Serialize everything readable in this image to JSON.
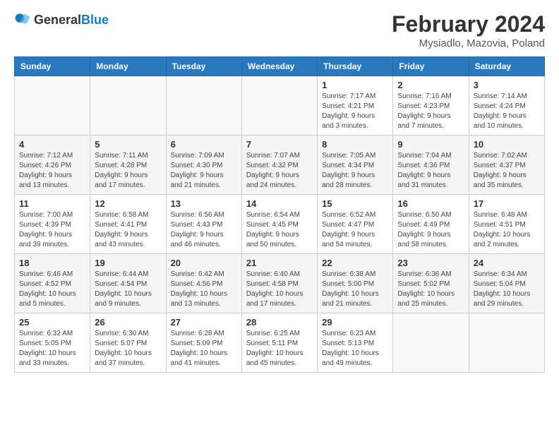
{
  "logo": {
    "general": "General",
    "blue": "Blue"
  },
  "header": {
    "title": "February 2024",
    "subtitle": "Mysiadlo, Mazovia, Poland"
  },
  "weekdays": [
    "Sunday",
    "Monday",
    "Tuesday",
    "Wednesday",
    "Thursday",
    "Friday",
    "Saturday"
  ],
  "weeks": [
    [
      {
        "day": "",
        "detail": ""
      },
      {
        "day": "",
        "detail": ""
      },
      {
        "day": "",
        "detail": ""
      },
      {
        "day": "",
        "detail": ""
      },
      {
        "day": "1",
        "detail": "Sunrise: 7:17 AM\nSunset: 4:21 PM\nDaylight: 9 hours\nand 3 minutes."
      },
      {
        "day": "2",
        "detail": "Sunrise: 7:16 AM\nSunset: 4:23 PM\nDaylight: 9 hours\nand 7 minutes."
      },
      {
        "day": "3",
        "detail": "Sunrise: 7:14 AM\nSunset: 4:24 PM\nDaylight: 9 hours\nand 10 minutes."
      }
    ],
    [
      {
        "day": "4",
        "detail": "Sunrise: 7:12 AM\nSunset: 4:26 PM\nDaylight: 9 hours\nand 13 minutes."
      },
      {
        "day": "5",
        "detail": "Sunrise: 7:11 AM\nSunset: 4:28 PM\nDaylight: 9 hours\nand 17 minutes."
      },
      {
        "day": "6",
        "detail": "Sunrise: 7:09 AM\nSunset: 4:30 PM\nDaylight: 9 hours\nand 21 minutes."
      },
      {
        "day": "7",
        "detail": "Sunrise: 7:07 AM\nSunset: 4:32 PM\nDaylight: 9 hours\nand 24 minutes."
      },
      {
        "day": "8",
        "detail": "Sunrise: 7:05 AM\nSunset: 4:34 PM\nDaylight: 9 hours\nand 28 minutes."
      },
      {
        "day": "9",
        "detail": "Sunrise: 7:04 AM\nSunset: 4:36 PM\nDaylight: 9 hours\nand 31 minutes."
      },
      {
        "day": "10",
        "detail": "Sunrise: 7:02 AM\nSunset: 4:37 PM\nDaylight: 9 hours\nand 35 minutes."
      }
    ],
    [
      {
        "day": "11",
        "detail": "Sunrise: 7:00 AM\nSunset: 4:39 PM\nDaylight: 9 hours\nand 39 minutes."
      },
      {
        "day": "12",
        "detail": "Sunrise: 6:58 AM\nSunset: 4:41 PM\nDaylight: 9 hours\nand 43 minutes."
      },
      {
        "day": "13",
        "detail": "Sunrise: 6:56 AM\nSunset: 4:43 PM\nDaylight: 9 hours\nand 46 minutes."
      },
      {
        "day": "14",
        "detail": "Sunrise: 6:54 AM\nSunset: 4:45 PM\nDaylight: 9 hours\nand 50 minutes."
      },
      {
        "day": "15",
        "detail": "Sunrise: 6:52 AM\nSunset: 4:47 PM\nDaylight: 9 hours\nand 54 minutes."
      },
      {
        "day": "16",
        "detail": "Sunrise: 6:50 AM\nSunset: 4:49 PM\nDaylight: 9 hours\nand 58 minutes."
      },
      {
        "day": "17",
        "detail": "Sunrise: 6:48 AM\nSunset: 4:51 PM\nDaylight: 10 hours\nand 2 minutes."
      }
    ],
    [
      {
        "day": "18",
        "detail": "Sunrise: 6:46 AM\nSunset: 4:52 PM\nDaylight: 10 hours\nand 5 minutes."
      },
      {
        "day": "19",
        "detail": "Sunrise: 6:44 AM\nSunset: 4:54 PM\nDaylight: 10 hours\nand 9 minutes."
      },
      {
        "day": "20",
        "detail": "Sunrise: 6:42 AM\nSunset: 4:56 PM\nDaylight: 10 hours\nand 13 minutes."
      },
      {
        "day": "21",
        "detail": "Sunrise: 6:40 AM\nSunset: 4:58 PM\nDaylight: 10 hours\nand 17 minutes."
      },
      {
        "day": "22",
        "detail": "Sunrise: 6:38 AM\nSunset: 5:00 PM\nDaylight: 10 hours\nand 21 minutes."
      },
      {
        "day": "23",
        "detail": "Sunrise: 6:36 AM\nSunset: 5:02 PM\nDaylight: 10 hours\nand 25 minutes."
      },
      {
        "day": "24",
        "detail": "Sunrise: 6:34 AM\nSunset: 5:04 PM\nDaylight: 10 hours\nand 29 minutes."
      }
    ],
    [
      {
        "day": "25",
        "detail": "Sunrise: 6:32 AM\nSunset: 5:05 PM\nDaylight: 10 hours\nand 33 minutes."
      },
      {
        "day": "26",
        "detail": "Sunrise: 6:30 AM\nSunset: 5:07 PM\nDaylight: 10 hours\nand 37 minutes."
      },
      {
        "day": "27",
        "detail": "Sunrise: 6:28 AM\nSunset: 5:09 PM\nDaylight: 10 hours\nand 41 minutes."
      },
      {
        "day": "28",
        "detail": "Sunrise: 6:25 AM\nSunset: 5:11 PM\nDaylight: 10 hours\nand 45 minutes."
      },
      {
        "day": "29",
        "detail": "Sunrise: 6:23 AM\nSunset: 5:13 PM\nDaylight: 10 hours\nand 49 minutes."
      },
      {
        "day": "",
        "detail": ""
      },
      {
        "day": "",
        "detail": ""
      }
    ]
  ]
}
